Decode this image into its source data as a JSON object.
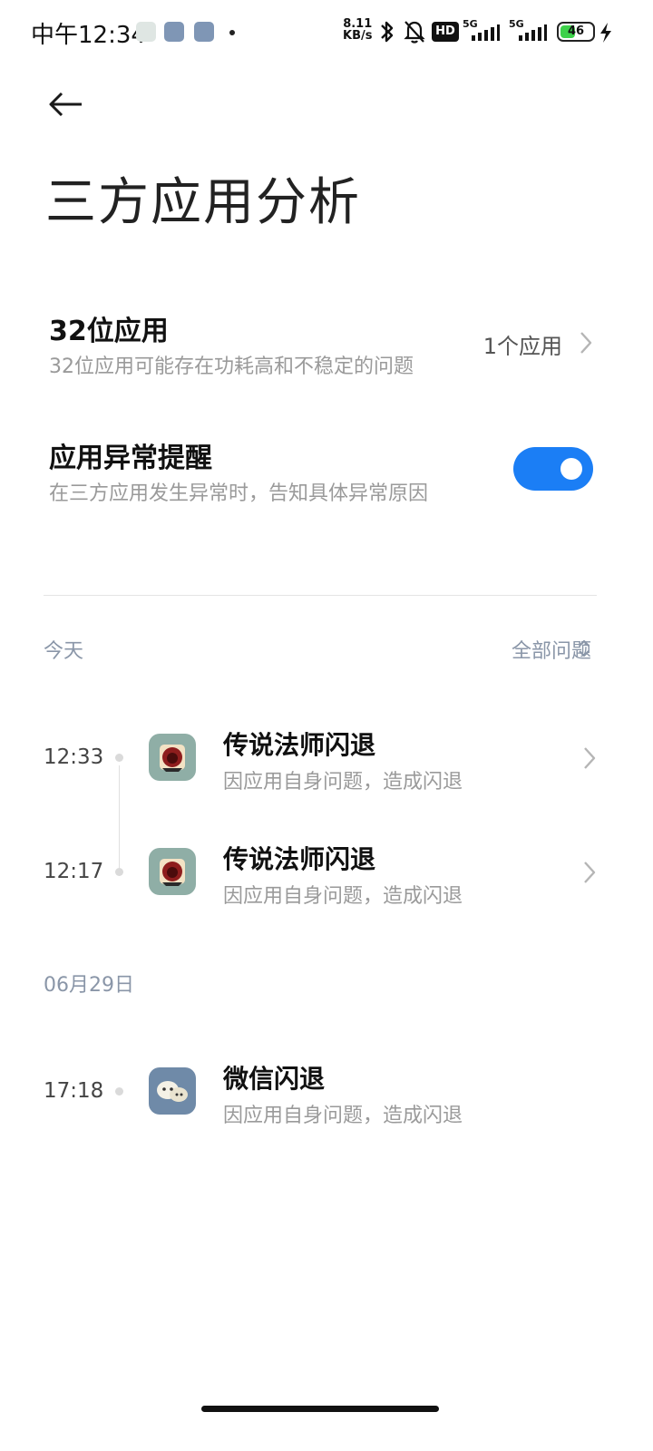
{
  "status_bar": {
    "time": "中午12:34",
    "speed_value": "8.11",
    "speed_unit": "KB/s",
    "hd_label": "HD",
    "net1_label": "5G",
    "net2_label": "5G",
    "battery_level": "46",
    "battery_fill_percent": 46,
    "icons": [
      "notification-app-icon",
      "notification-app-icon",
      "notification-app-icon",
      "bluetooth-icon",
      "bell-muted-icon",
      "hd-icon",
      "signal-icon",
      "signal-icon",
      "battery-icon",
      "charging-icon"
    ]
  },
  "header": {
    "title": "三方应用分析"
  },
  "settings": {
    "app32": {
      "title": "32位应用",
      "subtitle": "32位应用可能存在功耗高和不稳定的问题",
      "value": "1个应用"
    },
    "anomaly_alert": {
      "title": "应用异常提醒",
      "subtitle": "在三方应用发生异常时，告知具体异常原因",
      "enabled": true
    }
  },
  "filter": {
    "label": "全部问题"
  },
  "sections": [
    {
      "label": "今天",
      "events": [
        {
          "time": "12:33",
          "title": "传说法师闪退",
          "subtitle": "因应用自身问题，造成闪退"
        },
        {
          "time": "12:17",
          "title": "传说法师闪退",
          "subtitle": "因应用自身问题，造成闪退"
        }
      ]
    },
    {
      "label": "06月29日",
      "events": [
        {
          "time": "17:18",
          "title": "微信闪退",
          "subtitle": "因应用自身问题，造成闪退"
        }
      ]
    }
  ],
  "colors": {
    "accent": "#1b7ef5",
    "section_label": "#8a96a8",
    "app_icon_game_bg": "#8faea6",
    "app_icon_wechat_bg": "#6f8aa8"
  }
}
